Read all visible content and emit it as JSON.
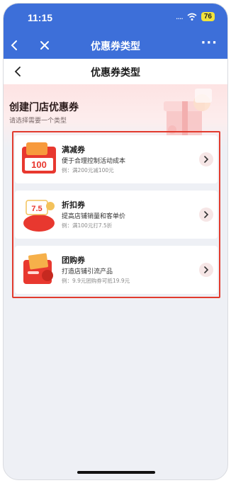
{
  "status_bar": {
    "time": "11:15",
    "signal": "....",
    "battery": "76"
  },
  "nav": {
    "title": "优惠券类型",
    "more": "···"
  },
  "page": {
    "title": "优惠券类型"
  },
  "banner": {
    "title": "创建门店优惠券",
    "subtitle": "请选择需要一个类型"
  },
  "coupons": [
    {
      "title": "满减券",
      "desc": "便于合理控制活动成本",
      "example": "例：满200元减100元",
      "badge": "100"
    },
    {
      "title": "折扣券",
      "desc": "提高店铺销量和客单价",
      "example": "例：满100元打7.5折",
      "badge": "7.5"
    },
    {
      "title": "团购券",
      "desc": "打造店铺引流产品",
      "example": "例：9.9元团购券可抵19.9元",
      "badge": ""
    }
  ],
  "colors": {
    "brand_blue": "#3d6fd9",
    "highlight_red": "#e23b2e",
    "coupon_red": "#e8382f"
  }
}
